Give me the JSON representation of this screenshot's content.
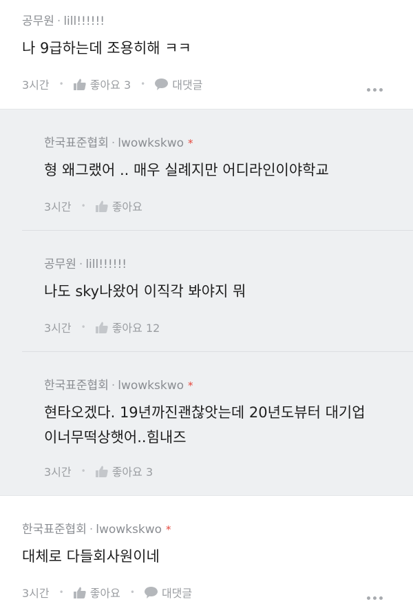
{
  "comments": [
    {
      "author": "공무원",
      "username": "lill!!!!!!",
      "text": [
        "나 9급하는데 조용히해 ㅋㅋ"
      ],
      "time": "3시간",
      "like_label": "좋아요 3",
      "reply_label": "대댓글"
    }
  ],
  "replies": [
    {
      "author": "한국표준협회",
      "username": "lwowkskwo",
      "badge": "*",
      "text": [
        "형 왜그랬어 .. 매우 실례지만 어디라인이야학교"
      ],
      "time": "3시간",
      "like_label": "좋아요"
    },
    {
      "author": "공무원",
      "username": "lill!!!!!!",
      "text": [
        "나도 sky나왔어 이직각 봐야지 뭐"
      ],
      "time": "3시간",
      "like_label": "좋아요 12"
    },
    {
      "author": "한국표준협회",
      "username": "lwowkskwo",
      "badge": "*",
      "text": [
        "현타오겠다. 19년까진괜찮앗는데 20년도뷰터 대기업",
        "이너무떡상햇어..힘내즈"
      ],
      "time": "3시간",
      "like_label": "좋아요 3"
    }
  ],
  "bottom_comment": {
    "author": "한국표준협회",
    "username": "lwowkskwo",
    "badge": "*",
    "text": [
      "대체로 다들회사원이네"
    ],
    "time": "3시간",
    "like_label": "좋아요",
    "reply_label": "대댓글"
  },
  "icons": {
    "like": "thumbs-up-icon",
    "reply": "speech-bubble-icon",
    "more": "more-dots-icon"
  },
  "colors": {
    "reply_background": "#eef0f2",
    "badge": "#e5483e",
    "meta_text": "#8a8d92"
  }
}
